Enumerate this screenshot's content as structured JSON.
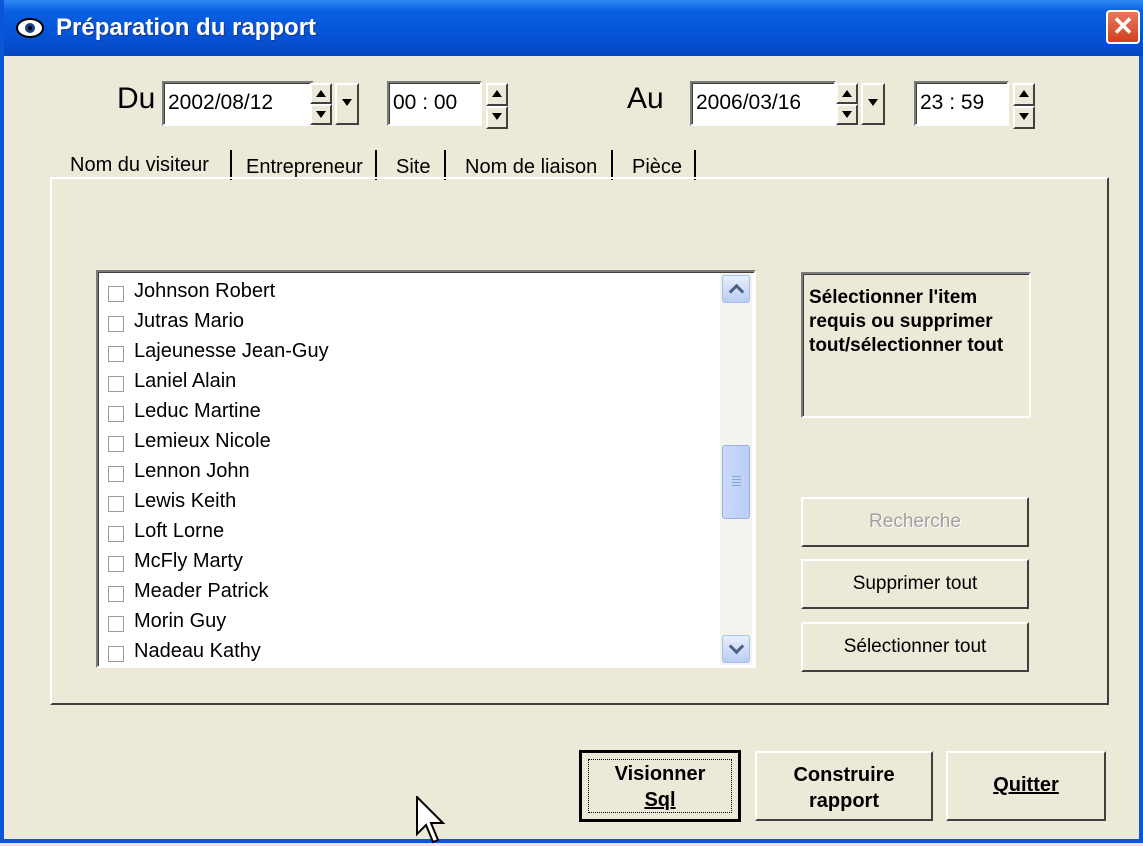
{
  "window": {
    "title": "Préparation du rapport",
    "close": "✕"
  },
  "date_range": {
    "from_label": "Du",
    "from_date": "2002/08/12",
    "from_time": "00 : 00",
    "to_label": "Au",
    "to_date": "2006/03/16",
    "to_time": "23 : 59"
  },
  "tabs": [
    "Nom du visiteur",
    "Entrepreneur",
    "Site",
    "Nom de liaison",
    "Pièce"
  ],
  "visitors": [
    "Johnson  Robert",
    "Jutras  Mario",
    "Lajeunesse  Jean-Guy",
    "Laniel  Alain",
    "Leduc  Martine",
    "Lemieux  Nicole",
    "Lennon  John",
    "Lewis  Keith",
    "Loft  Lorne",
    "McFly  Marty",
    "Meader  Patrick",
    "Morin  Guy",
    "Nadeau  Kathy"
  ],
  "help_text": "Sélectionner l'item requis ou supprimer tout/sélectionner tout",
  "buttons": {
    "search": "Recherche",
    "clear_all": "Supprimer tout",
    "select_all": "Sélectionner tout",
    "view_sql_line1": "Visionner",
    "view_sql_line2": "Sql",
    "build_line1": "Construire",
    "build_line2": "rapport",
    "quit": "Quitter"
  },
  "colors": {
    "titlebar": "#0554d8",
    "face": "#ece9d8",
    "close": "#d23f1c"
  }
}
